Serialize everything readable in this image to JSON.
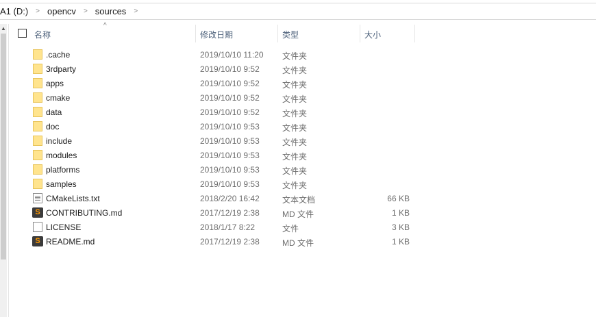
{
  "breadcrumb": [
    "A1 (D:)",
    "opencv",
    "sources"
  ],
  "columns": {
    "name": "名称",
    "date": "修改日期",
    "type": "类型",
    "size": "大小"
  },
  "files": [
    {
      "name": ".cache",
      "date": "2019/10/10 11:20",
      "type": "文件夹",
      "size": "",
      "icon": "folder"
    },
    {
      "name": "3rdparty",
      "date": "2019/10/10 9:52",
      "type": "文件夹",
      "size": "",
      "icon": "folder"
    },
    {
      "name": "apps",
      "date": "2019/10/10 9:52",
      "type": "文件夹",
      "size": "",
      "icon": "folder"
    },
    {
      "name": "cmake",
      "date": "2019/10/10 9:52",
      "type": "文件夹",
      "size": "",
      "icon": "folder"
    },
    {
      "name": "data",
      "date": "2019/10/10 9:52",
      "type": "文件夹",
      "size": "",
      "icon": "folder"
    },
    {
      "name": "doc",
      "date": "2019/10/10 9:53",
      "type": "文件夹",
      "size": "",
      "icon": "folder"
    },
    {
      "name": "include",
      "date": "2019/10/10 9:53",
      "type": "文件夹",
      "size": "",
      "icon": "folder"
    },
    {
      "name": "modules",
      "date": "2019/10/10 9:53",
      "type": "文件夹",
      "size": "",
      "icon": "folder"
    },
    {
      "name": "platforms",
      "date": "2019/10/10 9:53",
      "type": "文件夹",
      "size": "",
      "icon": "folder"
    },
    {
      "name": "samples",
      "date": "2019/10/10 9:53",
      "type": "文件夹",
      "size": "",
      "icon": "folder"
    },
    {
      "name": "CMakeLists.txt",
      "date": "2018/2/20 16:42",
      "type": "文本文档",
      "size": "66 KB",
      "icon": "txt"
    },
    {
      "name": "CONTRIBUTING.md",
      "date": "2017/12/19 2:38",
      "type": "MD 文件",
      "size": "1 KB",
      "icon": "subl"
    },
    {
      "name": "LICENSE",
      "date": "2018/1/17 8:22",
      "type": "文件",
      "size": "3 KB",
      "icon": "blank"
    },
    {
      "name": "README.md",
      "date": "2017/12/19 2:38",
      "type": "MD 文件",
      "size": "1 KB",
      "icon": "subl"
    }
  ]
}
